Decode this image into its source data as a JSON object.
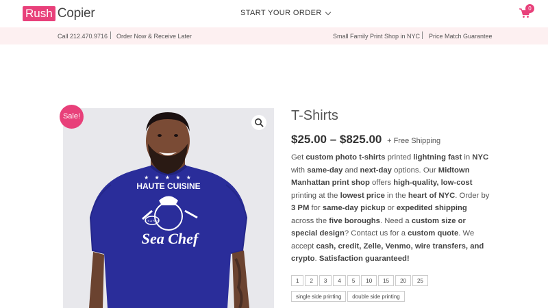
{
  "header": {
    "logo_box": "Rush",
    "logo_text": "Copier",
    "nav_order": "START YOUR ORDER",
    "cart_count": "0"
  },
  "infobar": {
    "phone": "Call 212.470.9716",
    "order": "Order Now & Receive Later",
    "shop": "Small Family Print Shop in NYC",
    "match": "Price Match Guarantee"
  },
  "product": {
    "sale_badge": "Sale!",
    "title": "T-Shirts",
    "price": "$25.00 – $825.00",
    "shipping": "+ Free Shipping",
    "shirt_text_top": "HAUTE CUISINE",
    "shirt_text_bottom": "Sea Chef",
    "shirt_text_small": "ITS A FISH",
    "description": [
      {
        "t": "Get "
      },
      {
        "b": "custom photo t-shirts"
      },
      {
        "t": " printed "
      },
      {
        "b": "lightning fast"
      },
      {
        "t": " in "
      },
      {
        "b": "NYC"
      },
      {
        "t": " with "
      },
      {
        "b": "same-day"
      },
      {
        "t": " and "
      },
      {
        "b": "next-day"
      },
      {
        "t": " options. Our "
      },
      {
        "b": "Midtown Manhattan print shop"
      },
      {
        "t": " offers "
      },
      {
        "b": "high-quality, low-cost"
      },
      {
        "t": " printing at the "
      },
      {
        "b": "lowest price"
      },
      {
        "t": " in the "
      },
      {
        "b": "heart of NYC"
      },
      {
        "t": ". Order by "
      },
      {
        "b": "3 PM"
      },
      {
        "t": " for "
      },
      {
        "b": "same-day pickup"
      },
      {
        "t": " or "
      },
      {
        "b": "expedited shipping"
      },
      {
        "t": " across the "
      },
      {
        "b": "five boroughs"
      },
      {
        "t": ". Need a "
      },
      {
        "b": "custom size or special design"
      },
      {
        "t": "? Contact us for a "
      },
      {
        "b": "custom quote"
      },
      {
        "t": ". We accept "
      },
      {
        "b": "cash, credit, Zelle, Venmo, wire transfers, and crypto"
      },
      {
        "t": ". "
      },
      {
        "b": "Satisfaction guaranteed!"
      }
    ],
    "quantities": [
      "1",
      "2",
      "3",
      "4",
      "5",
      "10",
      "15",
      "20",
      "25"
    ],
    "sides": [
      "single side printing",
      "double side printing"
    ]
  },
  "colors": {
    "brand_pink": "#e8407a",
    "infobar_bg": "#fdf0f1",
    "shirt_blue": "#2a2d9a"
  }
}
